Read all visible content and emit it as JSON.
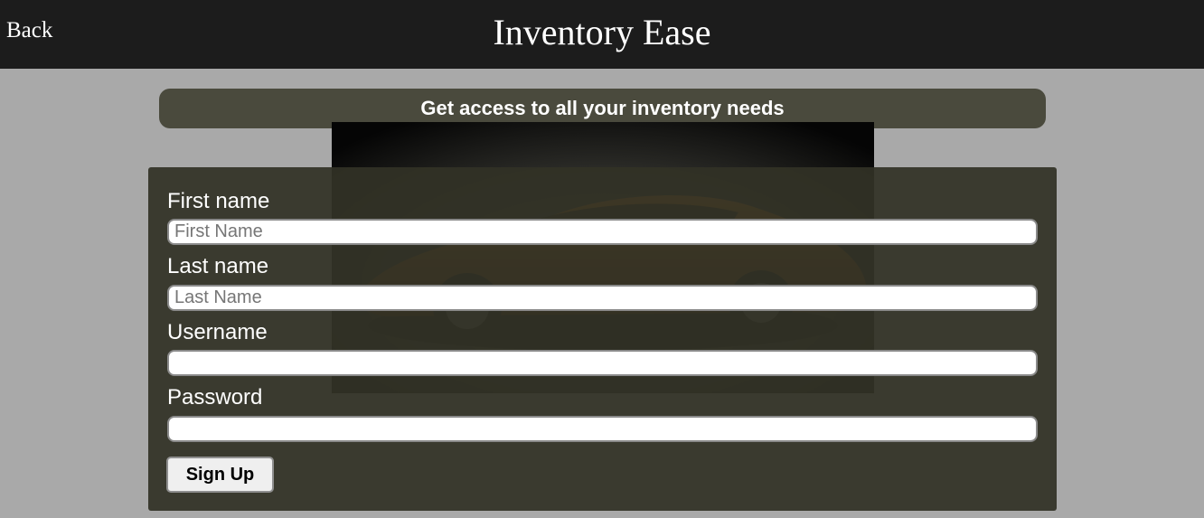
{
  "header": {
    "back_label": "Back",
    "title": "Inventory Ease"
  },
  "tagline": "Get access to all your inventory needs",
  "form": {
    "fields": [
      {
        "label": "First name",
        "placeholder": "First Name",
        "value": ""
      },
      {
        "label": "Last name",
        "placeholder": "Last Name",
        "value": ""
      },
      {
        "label": "Username",
        "placeholder": "",
        "value": ""
      },
      {
        "label": "Password",
        "placeholder": "",
        "value": ""
      }
    ],
    "submit_label": "Sign Up"
  },
  "colors": {
    "header_bg": "#1c1c1c",
    "page_bg": "#a9a9a9",
    "panel_bg": "#32322a",
    "tagline_bg": "#4a4a3d"
  },
  "hero_image": {
    "icon": "sports-car-image"
  }
}
